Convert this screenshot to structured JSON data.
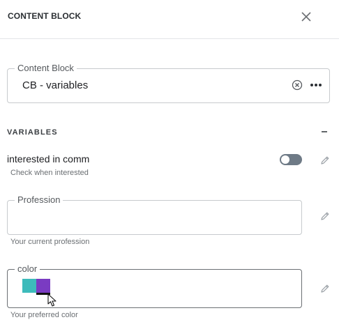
{
  "header": {
    "title": "CONTENT BLOCK",
    "close_icon": "close-icon"
  },
  "content_block_field": {
    "label": "Content Block",
    "value": "CB - variables",
    "clear_icon": "circle-x-icon",
    "more_icon": "more-horizontal-icon"
  },
  "variables_section": {
    "title": "VARIABLES",
    "collapse_icon": "minus-icon",
    "items": [
      {
        "type": "toggle",
        "label": "interested in comm",
        "hint": "Check when interested",
        "toggle_on": false,
        "edit_icon": "pencil-icon"
      },
      {
        "type": "text",
        "label": "Profession",
        "value": "",
        "hint": "Your current profession",
        "edit_icon": "pencil-icon"
      },
      {
        "type": "color",
        "label": "color",
        "swatches": [
          "#3dbbbb",
          "#7a3bc2"
        ],
        "selected_swatch": 1,
        "hint": "Your preferred color",
        "edit_icon": "pencil-icon"
      }
    ]
  }
}
